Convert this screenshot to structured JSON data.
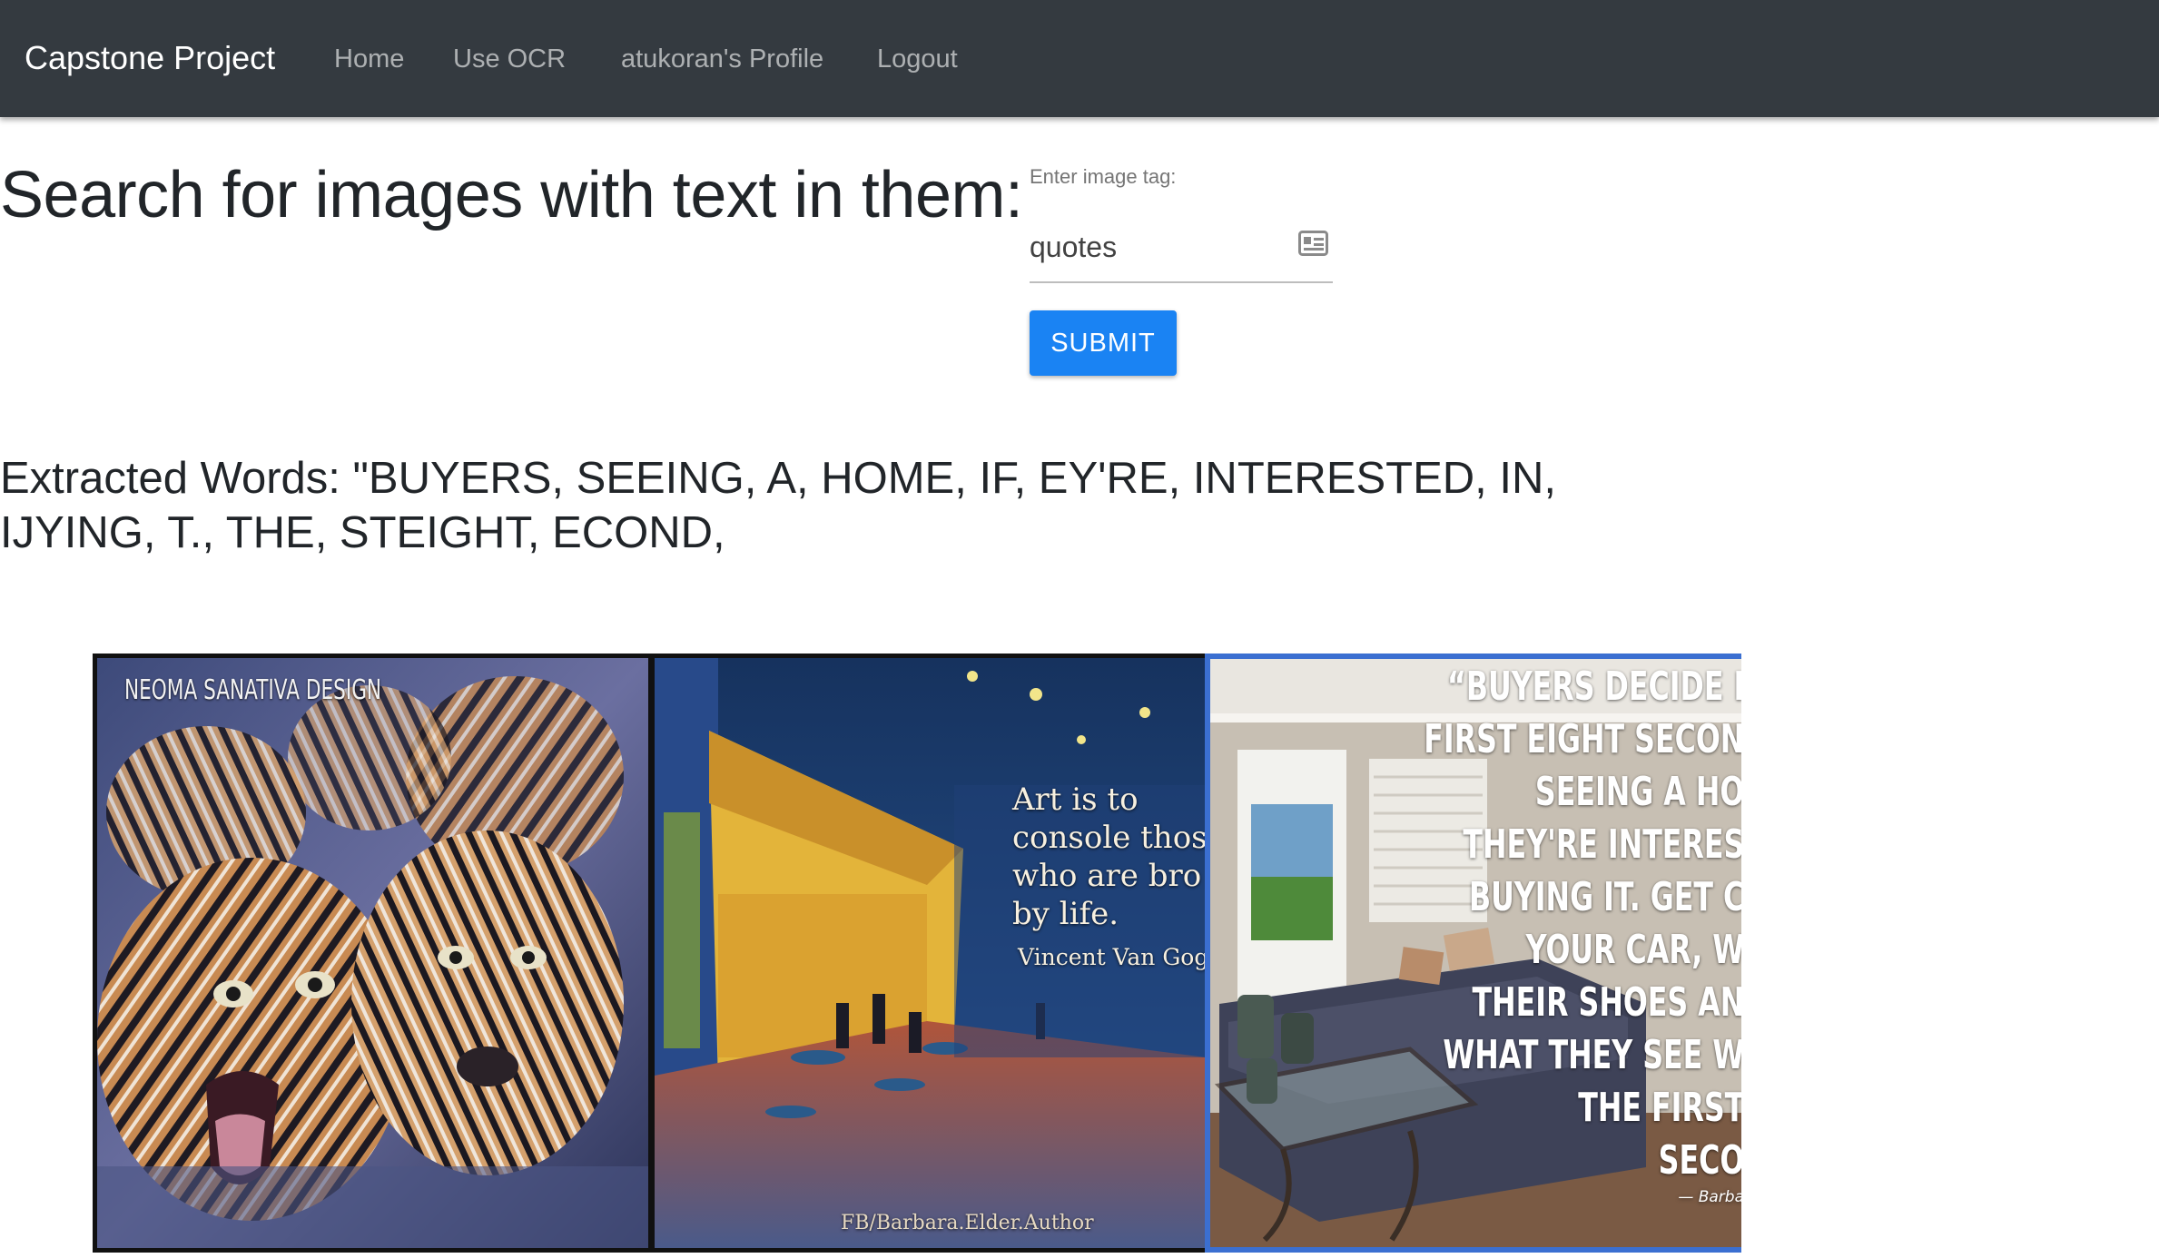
{
  "navbar": {
    "brand": "Capstone Project",
    "links": [
      "Home",
      "Use OCR",
      "atukoran's Profile",
      "Logout"
    ]
  },
  "main": {
    "heading": "Search for images with text in them:",
    "search": {
      "label": "Enter image tag:",
      "value": "quotes",
      "icon": "contact-card-icon"
    },
    "submit_label": "SUBMIT",
    "extracted_words": "Extracted Words: \"BUYERS, SEEING, A, HOME, IF, EY'RE, INTERESTED, IN, IJYING, T., THE, STEIGHT, ECOND,"
  },
  "gallery": {
    "images": [
      {
        "subject": "tigers",
        "watermark": "NEOMA SANATIVA DESIGN"
      },
      {
        "subject": "cafe terrace at night painting",
        "quote_lines": [
          "Art is to",
          "console thos",
          "who are bro",
          "by life."
        ],
        "author": "Vincent Van Gog",
        "credit": "FB/Barbara.Elder.Author"
      },
      {
        "subject": "living room",
        "quote_lines": [
          "“BUYERS DECIDE I",
          "FIRST EIGHT SECON",
          "SEEING A HO",
          "THEY'RE INTERES",
          "BUYING IT. GET C",
          "YOUR CAR, W",
          "THEIR SHOES AN",
          "WHAT THEY SEE W",
          "THE FIRST",
          "SECO"
        ],
        "credit": "— Barba"
      }
    ]
  },
  "colors": {
    "navbar_bg": "#343a40",
    "button_bg": "#1a83f3",
    "selected_border": "#3b6fd1"
  }
}
